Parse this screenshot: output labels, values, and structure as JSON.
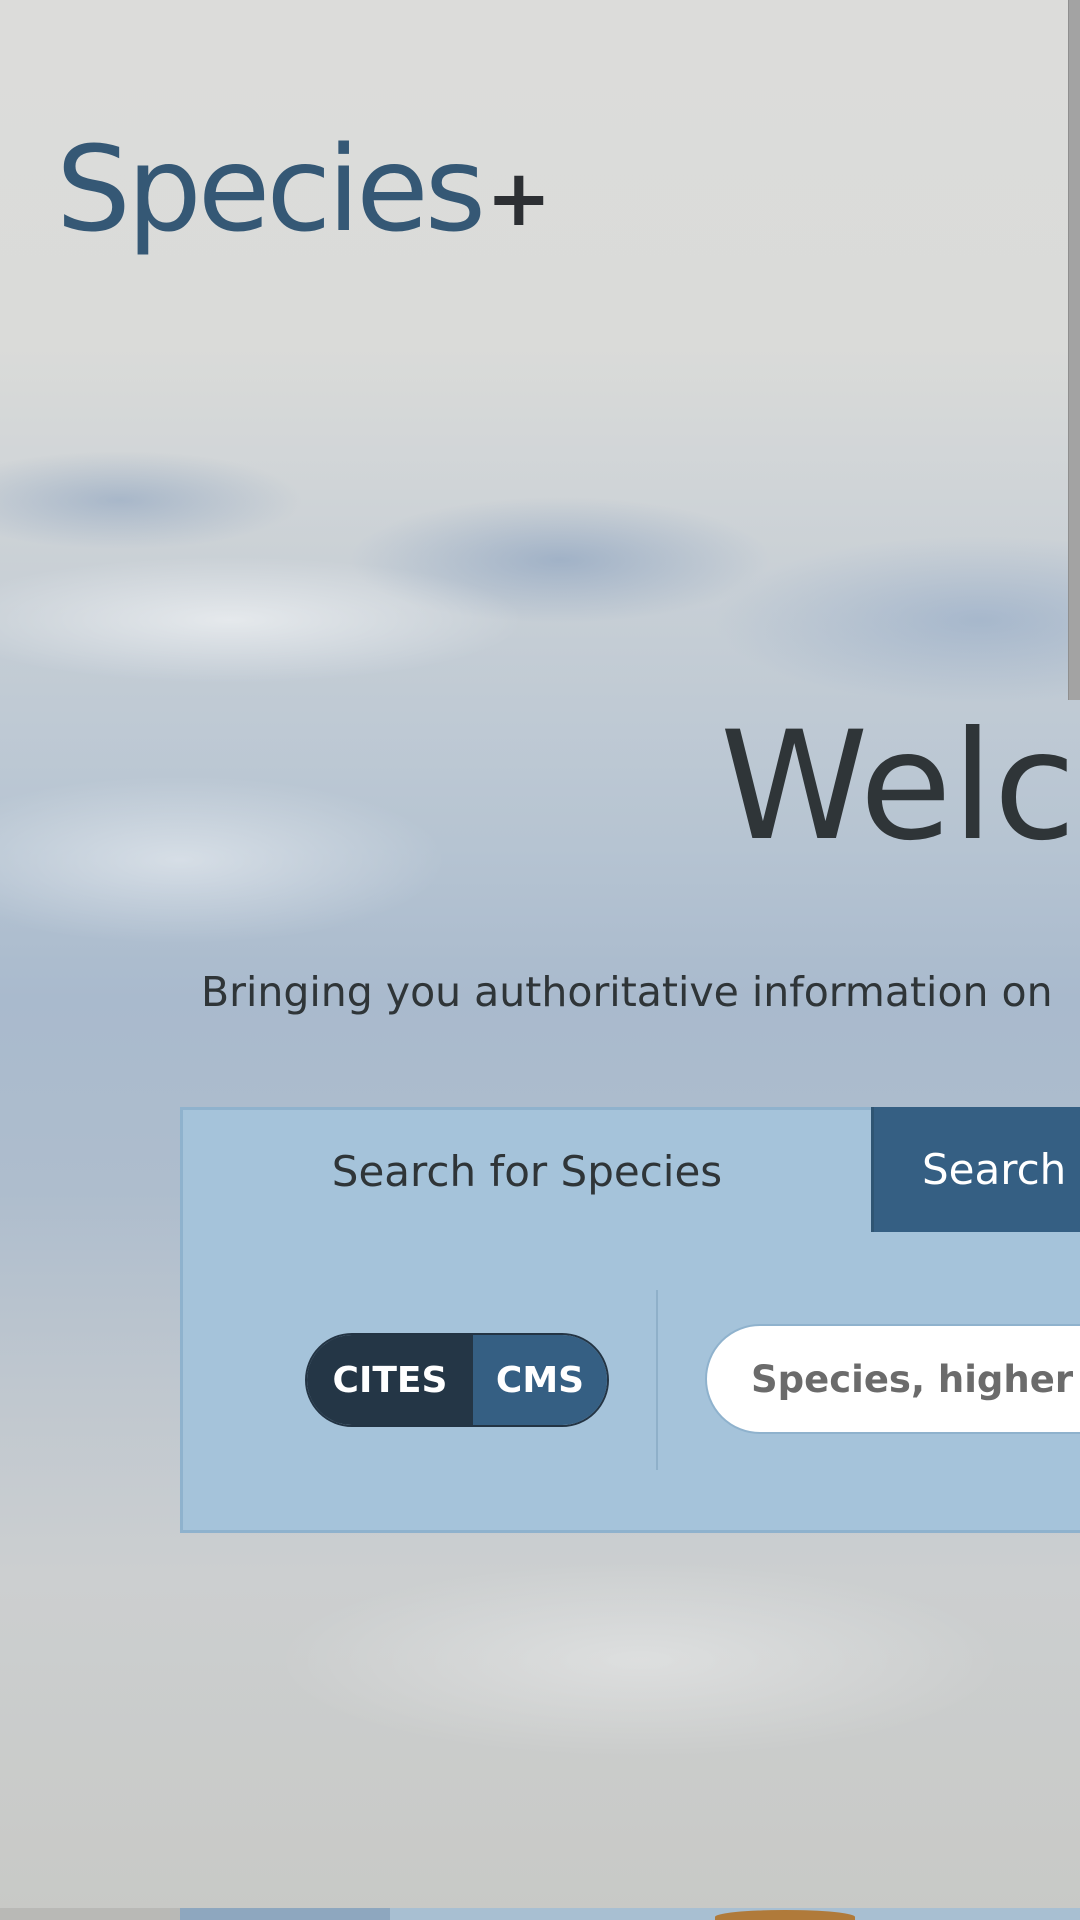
{
  "logo": {
    "word": "Species",
    "plus": "+"
  },
  "hero": {
    "welcome": "Welco",
    "tagline": "Bringing you authoritative information on"
  },
  "search": {
    "tabs": {
      "species": "Search for Species",
      "other": "Search f"
    },
    "toggle": {
      "cites": "CITES",
      "cms": "CMS",
      "active": "CITES"
    },
    "placeholder": "Species, higher ta"
  },
  "colors": {
    "brand": "#355875",
    "tab_active_bg": "#355f83",
    "panel_bg": "#a5c3da",
    "toggle_dark": "#243646"
  }
}
